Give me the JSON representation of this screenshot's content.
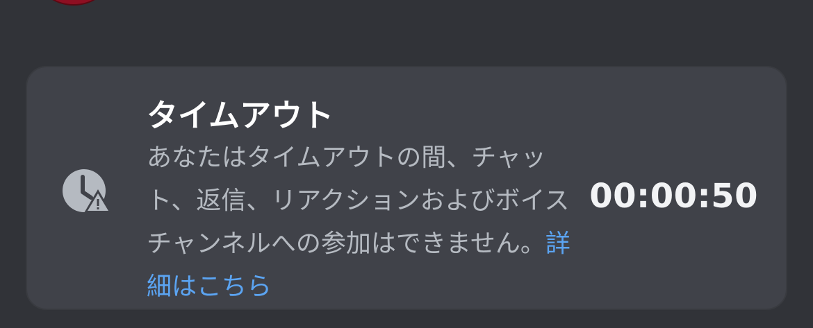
{
  "timeout_card": {
    "title": "タイムアウト",
    "description": "あなたはタイムアウトの間、チャット、返信、リアクションおよびボイスチャンネルへの参加はできません。",
    "learn_more_link": "詳細はこちら",
    "timer": "00:00:50",
    "icon": "clock-warning-icon"
  },
  "colors": {
    "background": "#313338",
    "card": "#404249",
    "link": "#5ba4f2",
    "avatar": "#8e0f22"
  }
}
